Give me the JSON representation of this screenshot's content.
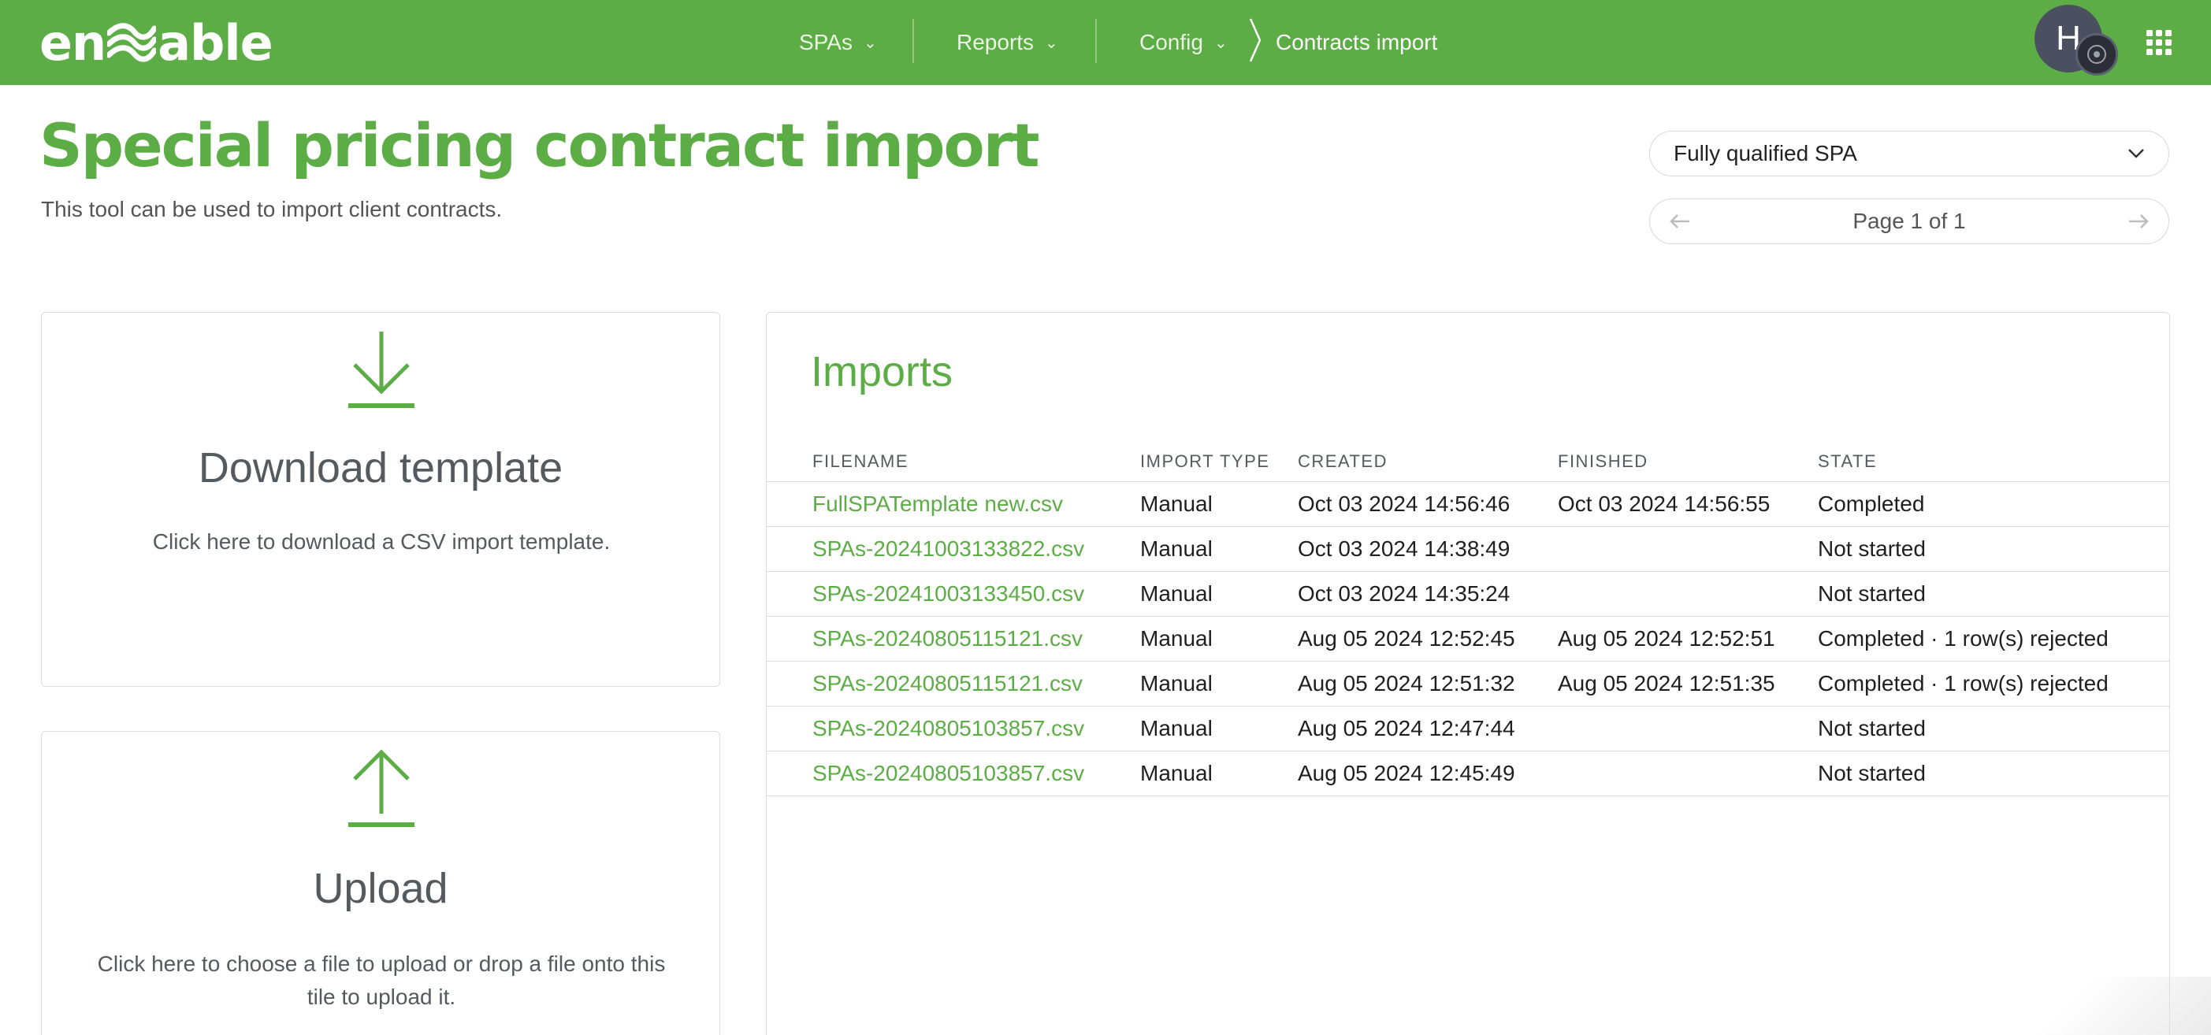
{
  "brand": {
    "logo_text_left": "en",
    "logo_text_right": "able",
    "accent": "#5cad45"
  },
  "nav": {
    "items": [
      {
        "label": "SPAs"
      },
      {
        "label": "Reports"
      },
      {
        "label": "Config"
      }
    ],
    "breadcrumb_current": "Contracts import"
  },
  "user": {
    "avatar_initial": "H"
  },
  "header": {
    "title": "Special pricing contract import",
    "subtitle": "This tool can be used to import client contracts."
  },
  "controls": {
    "select_value": "Fully qualified SPA",
    "pager_label": "Page 1 of 1"
  },
  "tiles": {
    "download": {
      "title": "Download template",
      "description": "Click here to download a CSV import template."
    },
    "upload": {
      "title": "Upload",
      "description": "Click here to choose a file to upload or drop a file onto this tile to upload it."
    }
  },
  "imports": {
    "title": "Imports",
    "columns": [
      "FILENAME",
      "IMPORT TYPE",
      "CREATED",
      "FINISHED",
      "STATE"
    ],
    "rows": [
      [
        "FullSPATemplate new.csv",
        "Manual",
        "Oct 03 2024 14:56:46",
        "Oct 03 2024 14:56:55",
        "Completed"
      ],
      [
        "SPAs-20241003133822.csv",
        "Manual",
        "Oct 03 2024 14:38:49",
        "",
        "Not started"
      ],
      [
        "SPAs-20241003133450.csv",
        "Manual",
        "Oct 03 2024 14:35:24",
        "",
        "Not started"
      ],
      [
        "SPAs-20240805115121.csv",
        "Manual",
        "Aug 05 2024 12:52:45",
        "Aug 05 2024 12:52:51",
        "Completed · 1 row(s) rejected"
      ],
      [
        "SPAs-20240805115121.csv",
        "Manual",
        "Aug 05 2024 12:51:32",
        "Aug 05 2024 12:51:35",
        "Completed · 1 row(s) rejected"
      ],
      [
        "SPAs-20240805103857.csv",
        "Manual",
        "Aug 05 2024 12:47:44",
        "",
        "Not started"
      ],
      [
        "SPAs-20240805103857.csv",
        "Manual",
        "Aug 05 2024 12:45:49",
        "",
        "Not started"
      ]
    ]
  }
}
